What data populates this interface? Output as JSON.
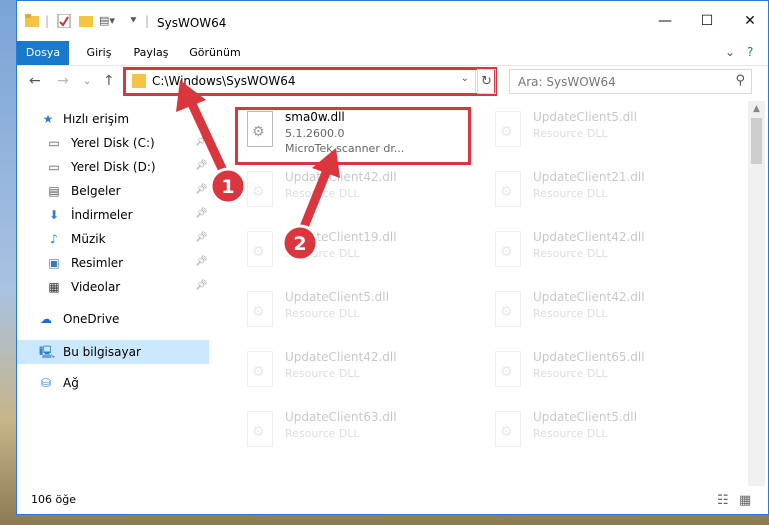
{
  "window": {
    "title": "SysWOW64",
    "minimize": "—",
    "maximize": "☐",
    "close": "✕"
  },
  "ribbon": {
    "tabs": [
      "Dosya",
      "Giriş",
      "Paylaş",
      "Görünüm"
    ],
    "expand_icon": "chevron-down-icon",
    "help_icon": "help-icon"
  },
  "address": {
    "path": "C:\\Windows\\SysWOW64",
    "search_placeholder": "Ara: SysWOW64"
  },
  "sidebar": {
    "items": [
      {
        "label": "Hızlı erişim",
        "icon": "star-icon"
      },
      {
        "label": "Yerel Disk (C:)",
        "icon": "drive-icon"
      },
      {
        "label": "Yerel Disk (D:)",
        "icon": "drive-icon"
      },
      {
        "label": "Belgeler",
        "icon": "documents-icon"
      },
      {
        "label": "İndirmeler",
        "icon": "download-icon"
      },
      {
        "label": "Müzik",
        "icon": "music-icon"
      },
      {
        "label": "Resimler",
        "icon": "pictures-icon"
      },
      {
        "label": "Videolar",
        "icon": "video-icon"
      },
      {
        "label": "OneDrive",
        "icon": "cloud-icon"
      },
      {
        "label": "Bu bilgisayar",
        "icon": "computer-icon"
      },
      {
        "label": "Ağ",
        "icon": "network-icon"
      }
    ]
  },
  "files": {
    "highlighted": {
      "name": "sma0w.dll",
      "version": "5.1.2600.0",
      "description": "MicroTek scanner dr..."
    },
    "items": [
      {
        "name": "UpdateClient5.dll",
        "type": "Resource DLL"
      },
      {
        "name": "UpdateClient42.dll",
        "type": "Resource DLL"
      },
      {
        "name": "UpdateClient21.dll",
        "type": "Resource DLL"
      },
      {
        "name": "UpdateClient19.dll",
        "type": "Resource DLL"
      },
      {
        "name": "UpdateClient42.dll",
        "type": "Resource DLL"
      },
      {
        "name": "UpdateClient5.dll",
        "type": "Resource DLL"
      },
      {
        "name": "UpdateClient42.dll",
        "type": "Resource DLL"
      },
      {
        "name": "UpdateClient42.dll",
        "type": "Resource DLL"
      },
      {
        "name": "UpdateClient65.dll",
        "type": "Resource DLL"
      },
      {
        "name": "UpdateClient63.dll",
        "type": "Resource DLL"
      },
      {
        "name": "UpdateClient5.dll",
        "type": "Resource DLL"
      }
    ]
  },
  "annotations": {
    "marker1": "1",
    "marker2": "2",
    "color": "#d9363e"
  },
  "status": {
    "count": "106 öğe"
  }
}
